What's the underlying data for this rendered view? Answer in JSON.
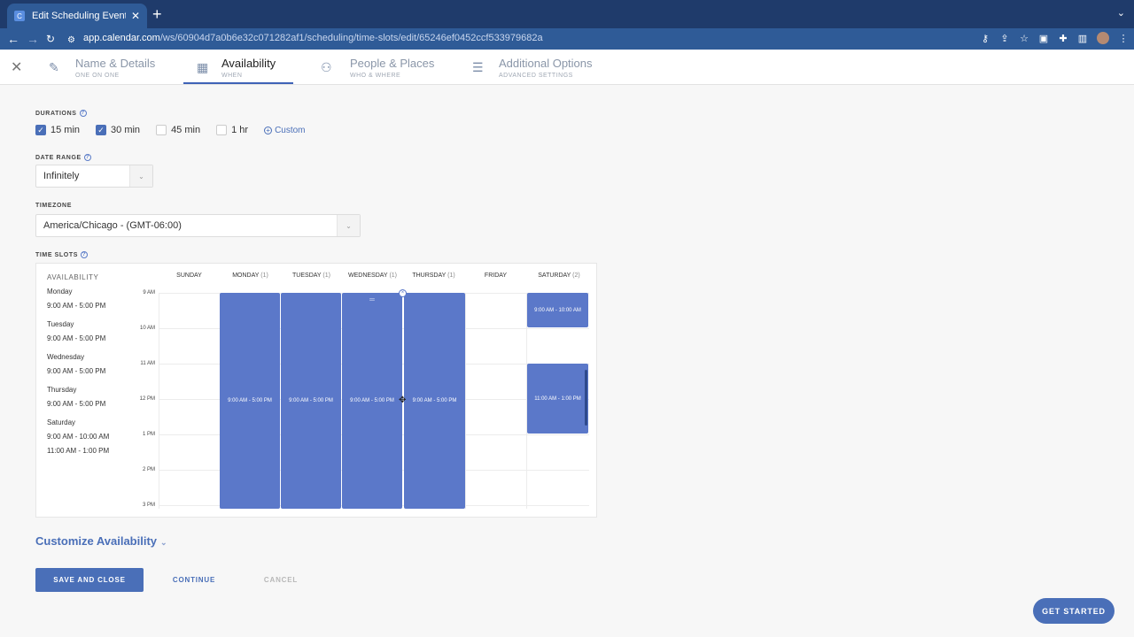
{
  "browser": {
    "tab_title": "Edit Scheduling Event | Calendar",
    "favicon_letter": "C",
    "new_tab": "+",
    "url_domain": "app.calendar.com",
    "url_path": "/ws/60904d7a0b6e32c071282af1/scheduling/time-slots/edit/65246ef0452ccf533979682a"
  },
  "header": {
    "steps": [
      {
        "title": "Name & Details",
        "subtitle": "ONE ON ONE"
      },
      {
        "title": "Availability",
        "subtitle": "WHEN"
      },
      {
        "title": "People & Places",
        "subtitle": "WHO & WHERE"
      },
      {
        "title": "Additional Options",
        "subtitle": "ADVANCED SETTINGS"
      }
    ],
    "active_step": "Availability"
  },
  "form": {
    "durations_label": "DURATIONS",
    "durations": [
      {
        "label": "15 min",
        "checked": true
      },
      {
        "label": "30 min",
        "checked": true
      },
      {
        "label": "45 min",
        "checked": false
      },
      {
        "label": "1 hr",
        "checked": false
      }
    ],
    "custom_label": "Custom",
    "date_range_label": "DATE RANGE",
    "date_range_value": "Infinitely",
    "timezone_label": "TIMEZONE",
    "timezone_value": "America/Chicago - (GMT-06:00)",
    "time_slots_label": "TIME SLOTS"
  },
  "availability": {
    "title": "AVAILABILITY",
    "days": [
      {
        "day": "Monday",
        "times": [
          "9:00 AM - 5:00 PM"
        ]
      },
      {
        "day": "Tuesday",
        "times": [
          "9:00 AM - 5:00 PM"
        ]
      },
      {
        "day": "Wednesday",
        "times": [
          "9:00 AM - 5:00 PM"
        ]
      },
      {
        "day": "Thursday",
        "times": [
          "9:00 AM - 5:00 PM"
        ]
      },
      {
        "day": "Saturday",
        "times": [
          "9:00 AM - 10:00 AM",
          "11:00 AM - 1:00 PM"
        ]
      }
    ]
  },
  "calendar": {
    "day_headers": [
      {
        "name": "SUNDAY",
        "count": ""
      },
      {
        "name": "MONDAY",
        "count": "(1)"
      },
      {
        "name": "TUESDAY",
        "count": "(1)"
      },
      {
        "name": "WEDNESDAY",
        "count": "(1)"
      },
      {
        "name": "THURSDAY",
        "count": "(1)"
      },
      {
        "name": "FRIDAY",
        "count": ""
      },
      {
        "name": "SATURDAY",
        "count": "(2)"
      }
    ],
    "hours": [
      "9 AM",
      "10 AM",
      "11 AM",
      "12 PM",
      "1 PM",
      "2 PM",
      "3 PM"
    ],
    "slots": {
      "mon": "9:00 AM - 5:00 PM",
      "tue": "9:00 AM - 5:00 PM",
      "wed": "9:00 AM - 5:00 PM",
      "thu": "9:00 AM - 5:00 PM",
      "sat1": "9:00 AM - 10:00 AM",
      "sat2": "11:00 AM - 1:00 PM"
    }
  },
  "customize_label": "Customize Availability",
  "buttons": {
    "save_close": "SAVE AND CLOSE",
    "continue": "CONTINUE",
    "cancel": "CANCEL",
    "get_started": "GET STARTED"
  },
  "colors": {
    "accent": "#4a6fb8",
    "slot": "#5b78c9",
    "browser_bg": "#1f3b6b"
  }
}
